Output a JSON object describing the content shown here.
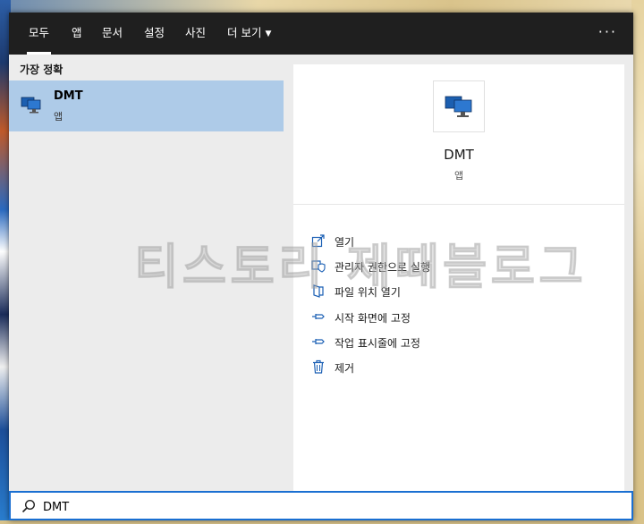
{
  "tabs": [
    {
      "label": "모두",
      "active": true
    },
    {
      "label": "앱"
    },
    {
      "label": "문서"
    },
    {
      "label": "설정"
    },
    {
      "label": "사진"
    },
    {
      "label": "더 보기"
    }
  ],
  "more_menu": "···",
  "results": {
    "section_label": "가장 정확",
    "best_match": {
      "name": "DMT",
      "type": "앱",
      "icon": "monitor-icon"
    }
  },
  "detail": {
    "name": "DMT",
    "type": "앱",
    "icon": "monitor-icon",
    "actions": [
      {
        "label": "열기",
        "icon": "open-icon"
      },
      {
        "label": "관리자 권한으로 실행",
        "icon": "shield-icon"
      },
      {
        "label": "파일 위치 열기",
        "icon": "folder-icon"
      },
      {
        "label": "시작 화면에 고정",
        "icon": "pin-icon"
      },
      {
        "label": "작업 표시줄에 고정",
        "icon": "pin-icon"
      },
      {
        "label": "제거",
        "icon": "trash-icon"
      }
    ]
  },
  "watermark": "티스토리 제때블로그",
  "search": {
    "value": "DMT",
    "icon": "search-icon"
  },
  "colors": {
    "accent": "#1a6fd1",
    "selected": "#aecbe8",
    "topbar": "#1f1f1f"
  }
}
